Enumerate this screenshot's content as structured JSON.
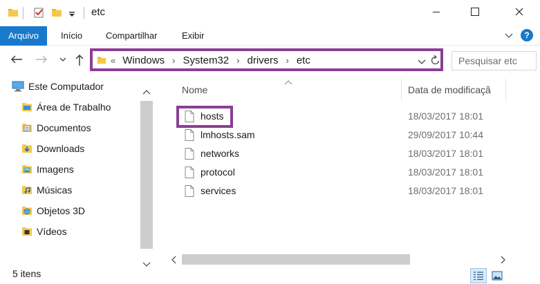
{
  "window": {
    "title": "etc"
  },
  "ribbon": {
    "tabs": [
      "Arquivo",
      "Início",
      "Compartilhar",
      "Exibir"
    ]
  },
  "address": {
    "overflow": "«",
    "crumbs": [
      "Windows",
      "System32",
      "drivers",
      "etc"
    ]
  },
  "search": {
    "placeholder": "Pesquisar etc"
  },
  "navpane": {
    "items": [
      {
        "label": "Este Computador",
        "icon": "computer-icon"
      },
      {
        "label": "Área de Trabalho",
        "icon": "desktop-folder-icon"
      },
      {
        "label": "Documentos",
        "icon": "documents-folder-icon"
      },
      {
        "label": "Downloads",
        "icon": "downloads-folder-icon"
      },
      {
        "label": "Imagens",
        "icon": "pictures-folder-icon"
      },
      {
        "label": "Músicas",
        "icon": "music-folder-icon"
      },
      {
        "label": "Objetos 3D",
        "icon": "3d-objects-folder-icon"
      },
      {
        "label": "Vídeos",
        "icon": "videos-folder-icon"
      }
    ]
  },
  "filelist": {
    "columns": {
      "name": "Nome",
      "date": "Data de modificaçã"
    },
    "rows": [
      {
        "name": "hosts",
        "date": "18/03/2017 18:01"
      },
      {
        "name": "lmhosts.sam",
        "date": "29/09/2017 10:44"
      },
      {
        "name": "networks",
        "date": "18/03/2017 18:01"
      },
      {
        "name": "protocol",
        "date": "18/03/2017 18:01"
      },
      {
        "name": "services",
        "date": "18/03/2017 18:01"
      }
    ]
  },
  "status": {
    "count": "5 itens"
  },
  "colors": {
    "accent": "#1979ca",
    "highlight": "#8c3d96",
    "folder": "#f5c84a"
  }
}
